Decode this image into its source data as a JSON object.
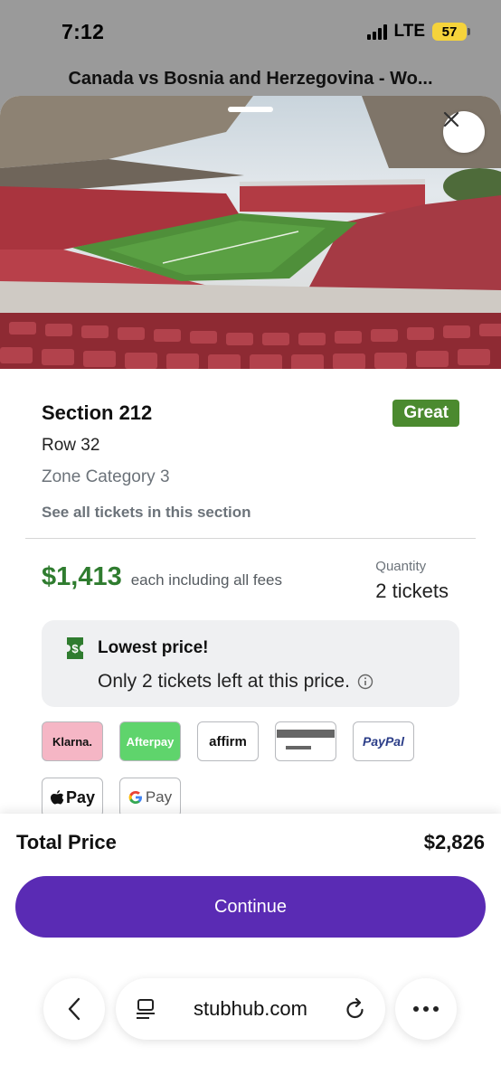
{
  "status_bar": {
    "time": "7:12",
    "network": "LTE",
    "battery": "57"
  },
  "page": {
    "header_title": "Canada vs Bosnia and Herzegovina - Wo..."
  },
  "listing": {
    "section": "Section 212",
    "badge": "Great",
    "badge_color": "#4b8a2f",
    "row": "Row 32",
    "zone": "Zone Category 3",
    "see_all": "See all tickets in this section",
    "price": "$1,413",
    "price_note": "each including all fees",
    "price_color": "#2f7c2f",
    "quantity_label": "Quantity",
    "quantity_value": "2 tickets"
  },
  "notice": {
    "icon": "ticket-dollar-icon",
    "title": "Lowest price!",
    "subtitle": "Only 2 tickets left at this price."
  },
  "payments": [
    {
      "name": "klarna",
      "label": "Klarna."
    },
    {
      "name": "afterpay",
      "label": "Afterpay"
    },
    {
      "name": "affirm",
      "label": "affirm"
    },
    {
      "name": "card",
      "label": ""
    },
    {
      "name": "paypal",
      "label": "PayPal"
    },
    {
      "name": "apple-pay",
      "label": "Pay"
    },
    {
      "name": "google-pay",
      "label": "Pay"
    }
  ],
  "checkout": {
    "total_label": "Total Price",
    "total_value": "$2,826",
    "continue_label": "Continue",
    "accent_color": "#5a2bb4"
  },
  "browser": {
    "url": "stubhub.com"
  }
}
